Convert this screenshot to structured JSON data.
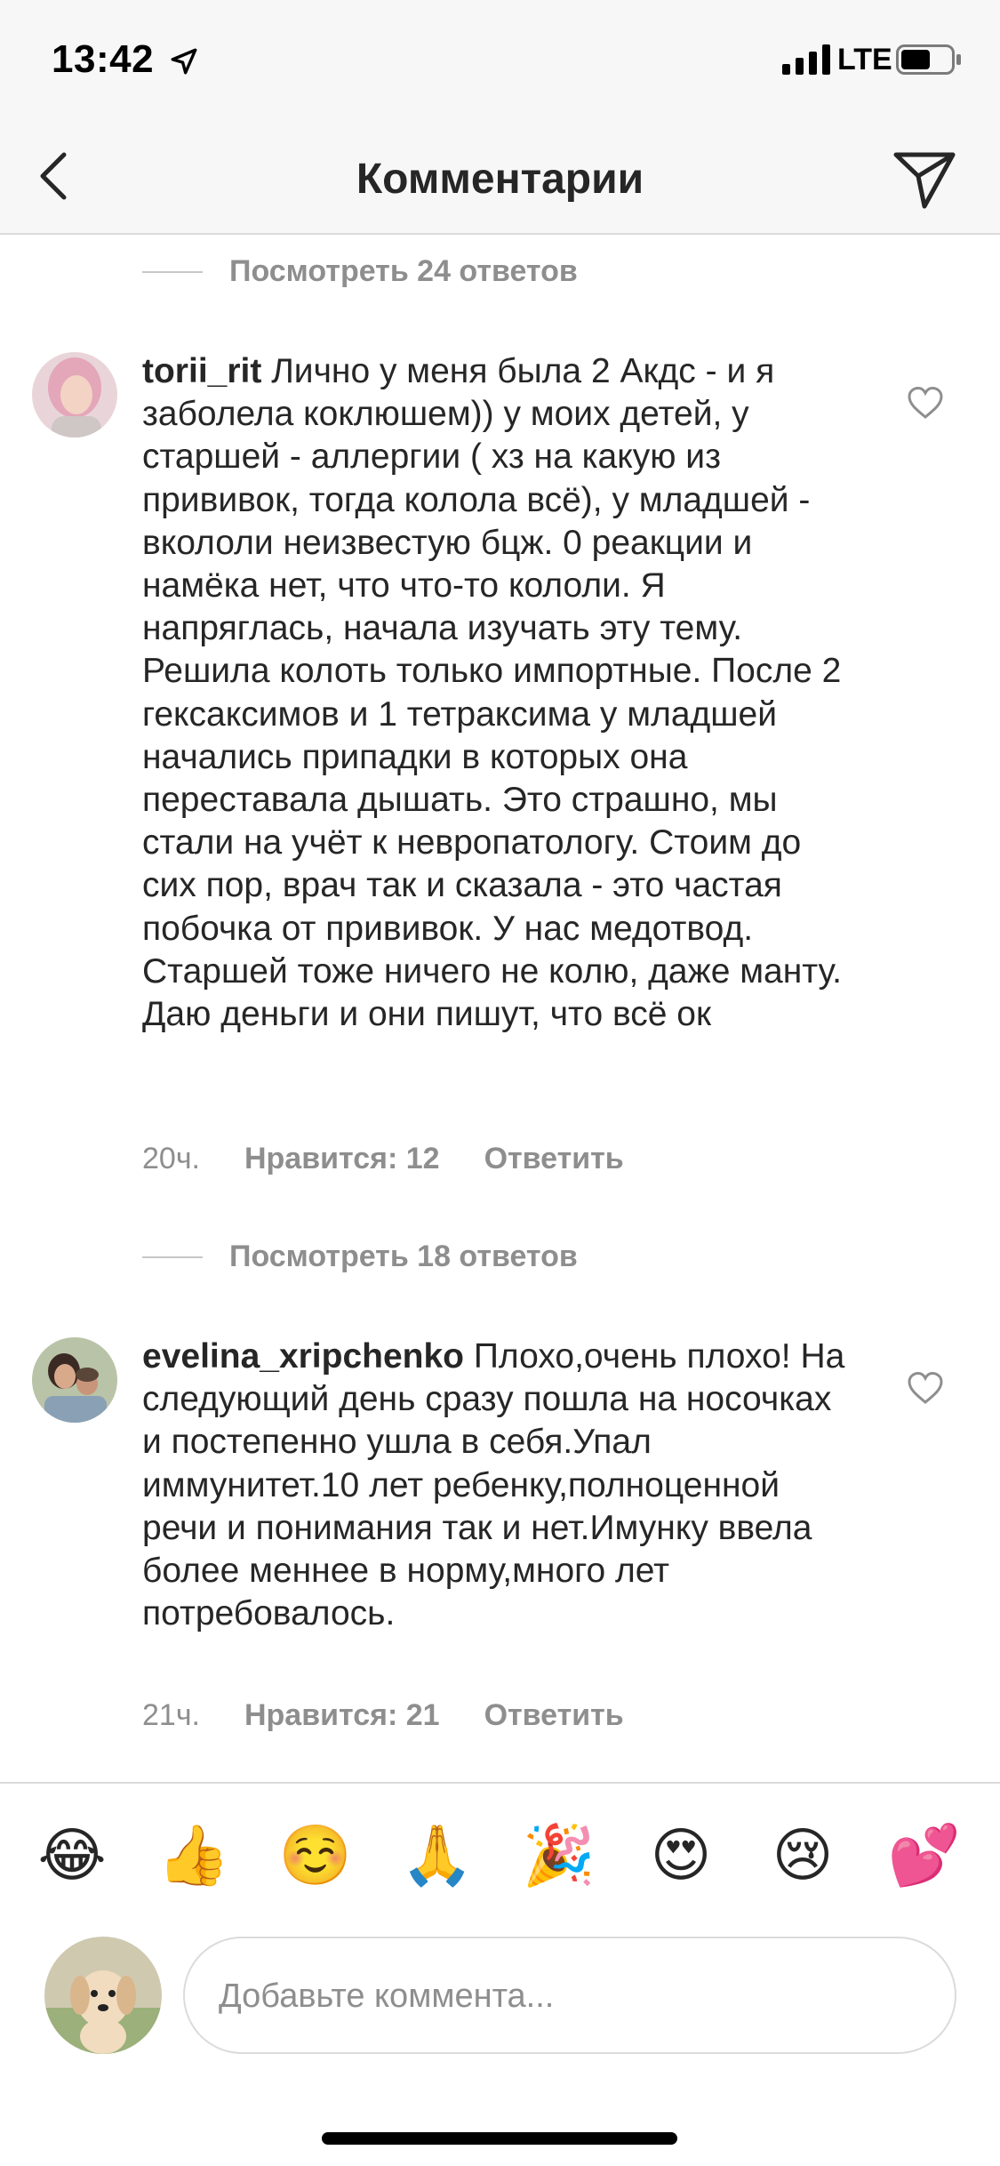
{
  "status_bar": {
    "time": "13:42",
    "network": "LTE"
  },
  "nav": {
    "title": "Комментарии"
  },
  "view_replies_top": "Посмотреть 24 ответов",
  "comments": [
    {
      "username": "torii_rit",
      "text": "Лично у меня была 2 Акдс - и я заболела коклюшем)) у моих детей, у старшей - аллергии ( хз на какую из прививок, тогда колола всё), у младшей - вкололи неизвестую бцж. 0 реакции и намёка нет, что что-то кололи. Я напряглась, начала изучать эту тему. Решила колоть только импортные. После 2 гексаксимов и 1 тетраксима у младшей начались припадки в которых она переставала дышать. Это страшно, мы стали на учёт к невропатологу. Стоим до сих пор, врач так и сказала - это частая побочка от прививок. У нас медотвод. Старшей тоже ничего не колю, даже манту. Даю деньги и они пишут, что всё ок",
      "time": "20ч.",
      "likes": "Нравится: 12",
      "reply": "Ответить",
      "view_replies": "Посмотреть 18 ответов"
    },
    {
      "username": "evelina_xripchenko",
      "text": "Плохо,очень плохо! На следующий день сразу пошла на носочках и постепенно ушла в себя.Упал иммунитет.10 лет ребенку,полноценной речи и понимания так и нет.Имунку ввела более меннее в норму,много лет потребовалось.",
      "time": "21ч.",
      "likes": "Нравится: 21",
      "reply": "Ответить"
    }
  ],
  "emojis": [
    "😂",
    "👍",
    "☺️",
    "🙏",
    "🎉",
    "😍",
    "😢",
    "💕"
  ],
  "input": {
    "placeholder": "Добавьте коммента..."
  },
  "colors": {
    "text": "#262626",
    "secondary": "#8e8e8e",
    "divider": "#dbdbdb",
    "bar_bg": "#f7f7f7"
  }
}
